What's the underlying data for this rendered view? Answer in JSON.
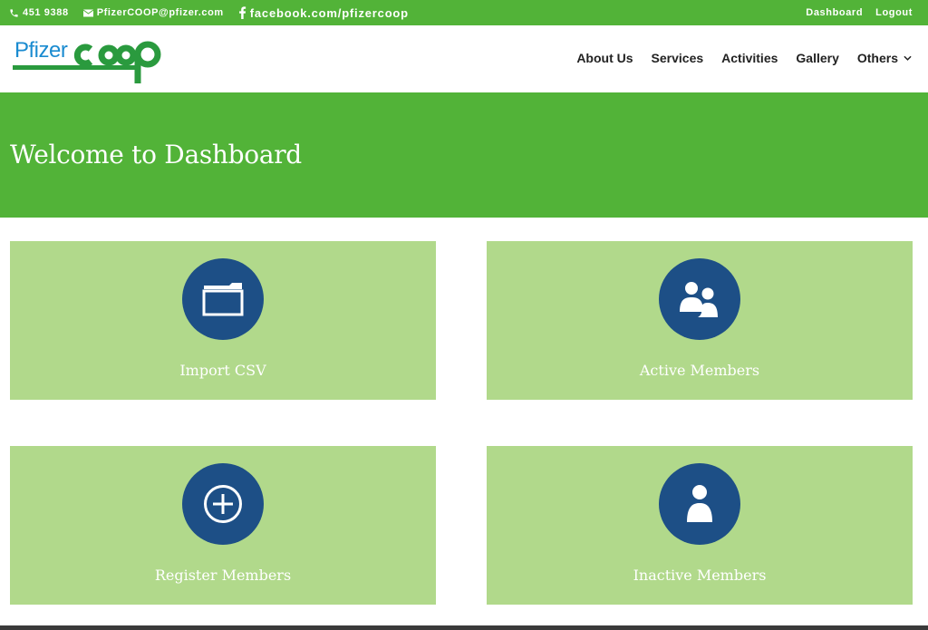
{
  "topbar": {
    "phone": "451 9388",
    "email": "PfizerCOOP@pfizer.com",
    "facebook": "facebook.com/pfizercoop",
    "links": [
      {
        "label": "Dashboard",
        "icon": "none"
      },
      {
        "label": "Logout",
        "icon": "none"
      }
    ],
    "icons": {
      "phone": "phone-icon",
      "email": "envelope-icon",
      "facebook": "facebook-icon"
    }
  },
  "header": {
    "logo_text": "Pfizer",
    "logo_mark": "coop",
    "nav": [
      {
        "label": "About Us"
      },
      {
        "label": "Services"
      },
      {
        "label": "Activities"
      },
      {
        "label": "Gallery"
      },
      {
        "label": "Others",
        "has_dropdown": true
      }
    ]
  },
  "hero": {
    "title": "Welcome to Dashboard"
  },
  "cards": [
    {
      "label": "Import CSV",
      "icon": "folder-icon"
    },
    {
      "label": "Active Members",
      "icon": "users-icon"
    },
    {
      "label": "Register Members",
      "icon": "plus-circle-icon"
    },
    {
      "label": "Inactive Members",
      "icon": "user-icon"
    }
  ],
  "colors": {
    "brand_green": "#52b338",
    "card_green": "#b1d98b",
    "icon_circle": "#1d4f86",
    "logo_blue": "#1a8bd0",
    "logo_green": "#2a9a3e"
  }
}
